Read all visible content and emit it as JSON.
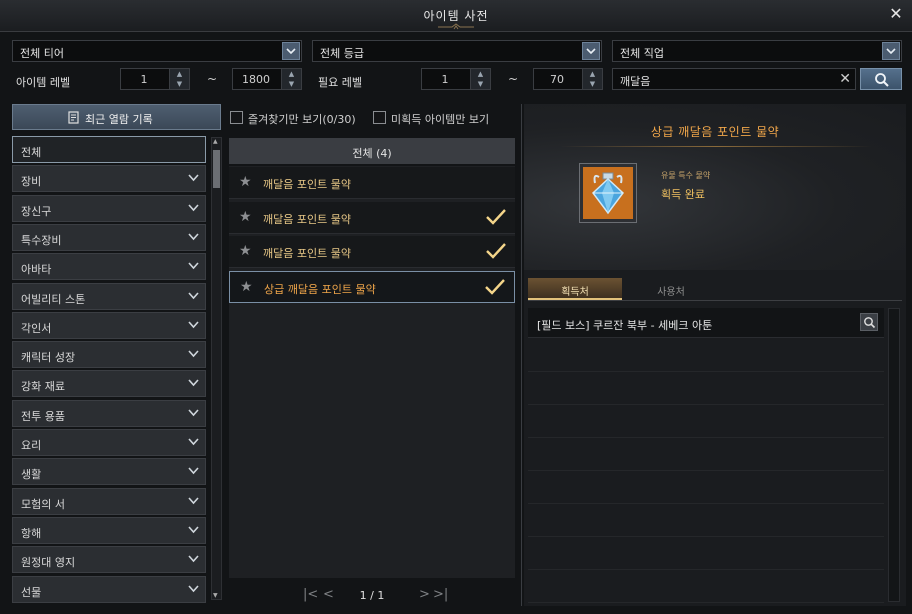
{
  "window": {
    "title": "아이템 사전",
    "close_icon": "close-icon"
  },
  "filters": {
    "tier": "전체 티어",
    "grade": "전체 등급",
    "job": "전체 직업",
    "item_level_label": "아이템 레벨",
    "item_level_min": "1",
    "item_level_max": "1800",
    "required_level_label": "필요 레벨",
    "required_level_min": "1",
    "required_level_max": "70",
    "tilde": "~",
    "search_value": "깨달음"
  },
  "sidebar": {
    "recent_label": "최근 열람 기록",
    "items": [
      {
        "label": "전체"
      },
      {
        "label": "장비"
      },
      {
        "label": "장신구"
      },
      {
        "label": "특수장비"
      },
      {
        "label": "아바타"
      },
      {
        "label": "어빌리티 스톤"
      },
      {
        "label": "각인서"
      },
      {
        "label": "캐릭터 성장"
      },
      {
        "label": "강화 재료"
      },
      {
        "label": "전투 용품"
      },
      {
        "label": "요리"
      },
      {
        "label": "생활"
      },
      {
        "label": "모험의 서"
      },
      {
        "label": "항해"
      },
      {
        "label": "원정대 영지"
      },
      {
        "label": "선물"
      }
    ]
  },
  "list": {
    "favorites_only": "즐겨찾기만 보기(0/30)",
    "unacquired_only": "미획득 아이템만 보기",
    "header": "전체 (4)",
    "rows": [
      {
        "name": "깨달음 포인트 물약",
        "acquired": false
      },
      {
        "name": "깨달음 포인트 물약",
        "acquired": true
      },
      {
        "name": "깨달음 포인트 물약",
        "acquired": true
      },
      {
        "name": "상급 깨달음 포인트 물약",
        "acquired": true
      }
    ],
    "page": "1 / 1"
  },
  "detail": {
    "title": "상급 깨달음 포인트 물약",
    "subtitle": "유물 특수 물약",
    "status": "획득 완료",
    "tab_acquire": "획득처",
    "tab_use": "사용처",
    "sources": [
      "[필드 보스] 쿠르잔 북부 - 세베크 아툰"
    ]
  },
  "colors": {
    "accent": "#f0a64a",
    "check": "#f4d58a"
  }
}
